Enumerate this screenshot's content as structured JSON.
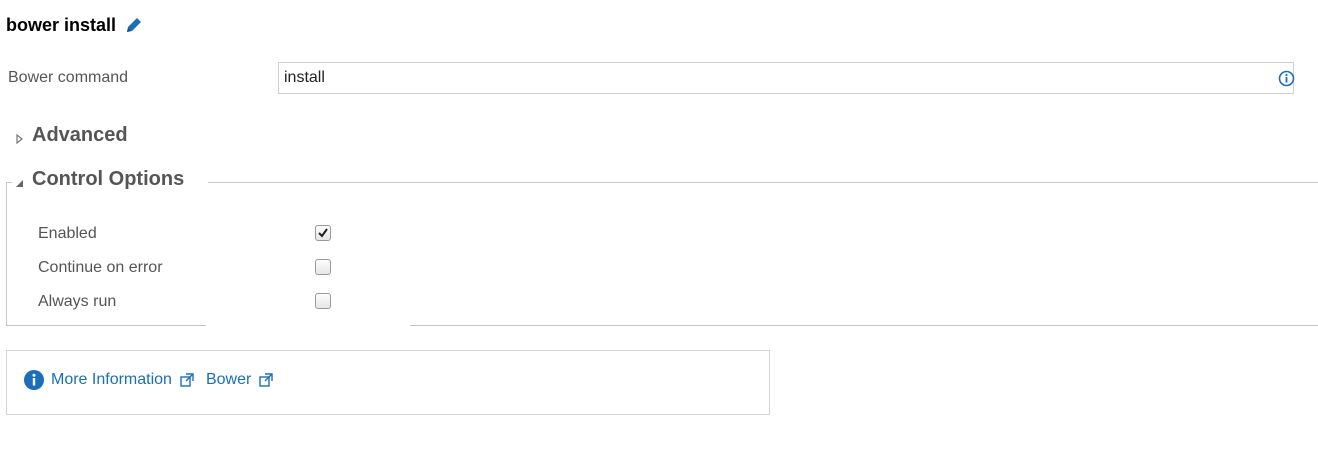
{
  "header": {
    "title": "bower install",
    "edit_icon": "pencil-icon"
  },
  "fields": {
    "bower_command_label": "Bower command",
    "bower_command_value": "install",
    "info_icon": "info-circle-icon"
  },
  "sections": {
    "advanced": "Advanced",
    "control_options": "Control Options"
  },
  "control_options": {
    "enabled": {
      "label": "Enabled",
      "checked": true
    },
    "continue_on_error": {
      "label": "Continue on error",
      "checked": false
    },
    "always_run": {
      "label": "Always run",
      "checked": false
    }
  },
  "info_panel": {
    "more_info_link": "More Information",
    "bower_link": "Bower"
  },
  "colors": {
    "accent": "#1a6fb8",
    "title": "#000000",
    "label": "#555555",
    "border": "#c8c8c8"
  }
}
